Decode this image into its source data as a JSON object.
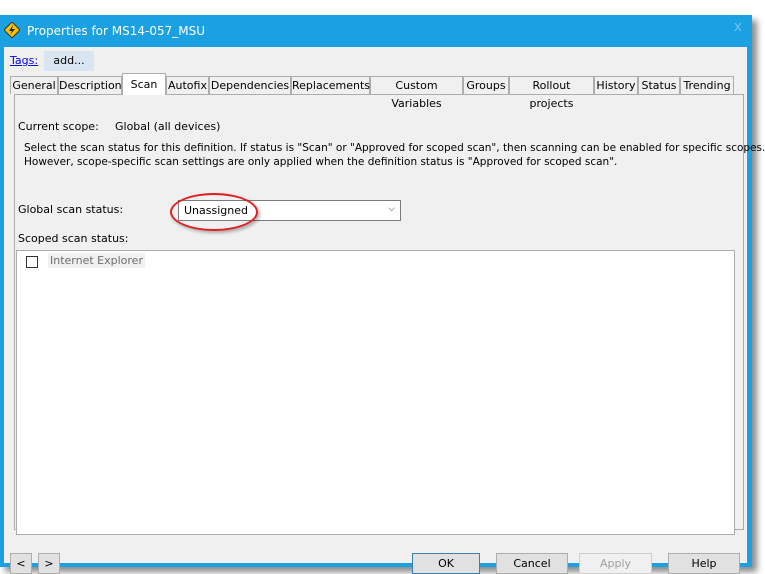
{
  "window": {
    "title": "Properties for MS14-057_MSU",
    "close_icon": "x"
  },
  "tags": {
    "label": "Tags:",
    "add_label": "add..."
  },
  "tabs": [
    {
      "label": "General"
    },
    {
      "label": "Description"
    },
    {
      "label": "Scan",
      "selected": true
    },
    {
      "label": "Autofix"
    },
    {
      "label": "Dependencies"
    },
    {
      "label": "Replacements"
    },
    {
      "label": "Custom Variables"
    },
    {
      "label": "Groups"
    },
    {
      "label": "Rollout projects"
    },
    {
      "label": "History"
    },
    {
      "label": "Status"
    },
    {
      "label": "Trending"
    }
  ],
  "scan": {
    "current_scope_label": "Current scope:",
    "current_scope_value": "Global (all devices)",
    "description_line1": "Select the scan status for this definition.  If status is \"Scan\" or \"Approved for scoped scan\", then scanning can be enabled for specific scopes.",
    "description_line2": "However, scope-specific scan settings are only applied when the definition status is \"Approved for scoped scan\".",
    "global_label": "Global scan status:",
    "global_value": "Unassigned",
    "scoped_label": "Scoped scan status:",
    "scoped_items": [
      {
        "label": "Internet Explorer",
        "checked": false
      }
    ]
  },
  "footer": {
    "prev": "<",
    "next": ">",
    "ok": "OK",
    "cancel": "Cancel",
    "apply": "Apply",
    "help": "Help"
  },
  "colors": {
    "titlebar": "#1ba1e2",
    "highlight_ring": "#e02020"
  }
}
